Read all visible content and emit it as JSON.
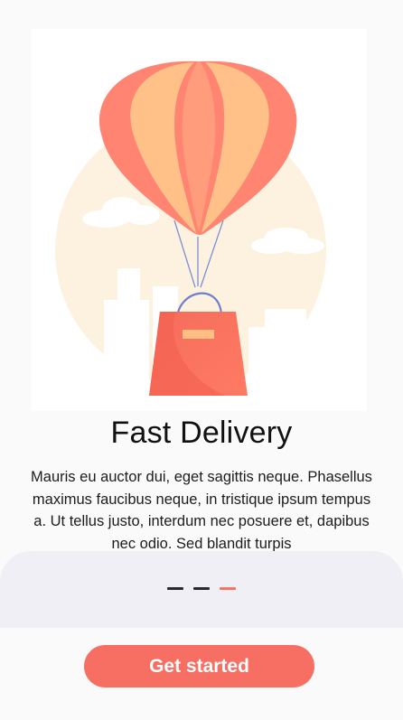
{
  "onboarding": {
    "title": "Fast Delivery",
    "description": "Mauris eu auctor dui, eget sagittis neque. Phasellus maximus faucibus neque, in tristique ipsum tempus a. Ut tellus justo, interdum nec posuere et, dapibus nec odio. Sed blandit turpis",
    "illustration": "hot-air-balloon-carrying-shopping-bag"
  },
  "pager": {
    "page_count": 3,
    "active_index": 2
  },
  "actions": {
    "get_started_label": "Get started"
  },
  "colors": {
    "accent": "#f76e62",
    "indicator_inactive": "#2a2a2a",
    "indicator_active": "#f47563",
    "panel_background": "#f0eff5",
    "page_background": "#fafafa"
  }
}
